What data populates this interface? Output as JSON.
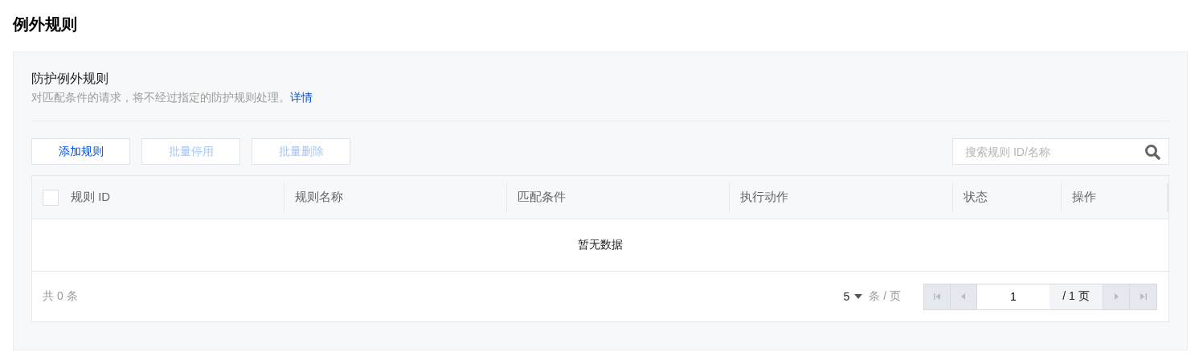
{
  "page_title": "例外规则",
  "panel": {
    "title": "防护例外规则",
    "description": "对匹配条件的请求，将不经过指定的防护规则处理。",
    "link": "详情"
  },
  "buttons": [
    {
      "label": "添加规则",
      "disabled": false
    },
    {
      "label": "批量停用",
      "disabled": true
    },
    {
      "label": "批量删除",
      "disabled": true
    }
  ],
  "search": {
    "placeholder": "搜索规则 ID/名称"
  },
  "table": {
    "select_all": {
      "checked": false
    },
    "columns": [
      "规则 ID",
      "规则名称",
      "匹配条件",
      "执行动作",
      "状态",
      "操作"
    ],
    "empty_text": "暂无数据"
  },
  "pagination": {
    "total": "共 0 条",
    "page_size": "5",
    "page_size_unit": "条 / 页",
    "page": "1",
    "page_count": "/ 1 页",
    "nav": [
      {
        "kind": "first",
        "disabled": true
      },
      {
        "kind": "prev",
        "disabled": true
      },
      {
        "kind": "next",
        "disabled": true
      },
      {
        "kind": "last",
        "disabled": true
      }
    ]
  }
}
